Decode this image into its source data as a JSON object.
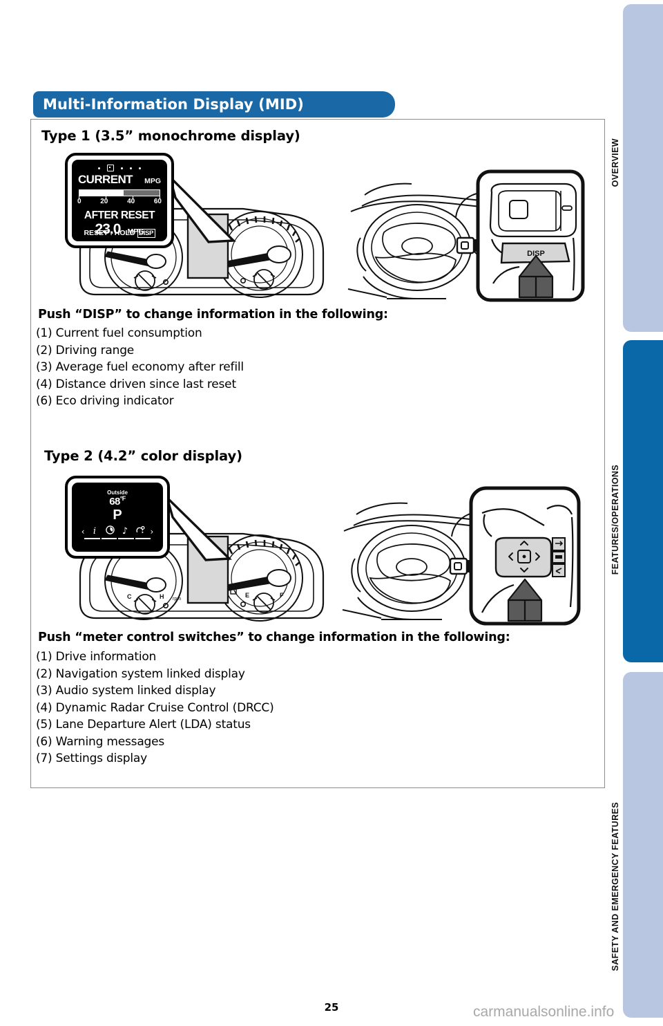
{
  "header": {
    "title": "Multi-Information Display (MID)"
  },
  "side_tabs": [
    {
      "label": "OVERVIEW",
      "active": false,
      "color": "#b9c6e2"
    },
    {
      "label": "FEATURES/OPERATIONS",
      "active": true,
      "color": "#0a68a8"
    },
    {
      "label": "SAFETY AND EMERGENCY FEATURES",
      "active": false,
      "color": "#b9c6e2"
    }
  ],
  "type1": {
    "heading": "Type 1 (3.5” monochrome display)",
    "lead": "Push “DISP” to change information in the following:",
    "items": [
      "(1) Current fuel consumption",
      "(2) Driving range",
      "(3) Average fuel economy after refill",
      "(4) Distance driven since last reset",
      "(6) Eco driving indicator"
    ],
    "screen": {
      "label_current": "CURRENT",
      "unit_mpg": "MPG",
      "scale": [
        "0",
        "20",
        "40",
        "60"
      ],
      "bar_value": 33,
      "bar_max": 60,
      "label_after_reset": "AFTER RESET",
      "value_after_reset": "23.0",
      "unit_after_reset": "MPG",
      "reset_hint": "RESET : HOLD",
      "reset_badge": "DISP",
      "dot_count": 5,
      "dot_selected_index": 1
    },
    "callout": {
      "button_label": "DISP"
    }
  },
  "type2": {
    "heading": "Type 2 (4.2” color display)",
    "lead": "Push “meter control switches” to change information in the following:",
    "items": [
      "(1) Drive information",
      "(2) Navigation system linked display",
      "(3) Audio system linked display",
      "(4) Dynamic Radar Cruise Control (DRCC)",
      "(5) Lane Departure Alert (LDA) status",
      "(6) Warning messages",
      "(7) Settings display"
    ],
    "screen": {
      "outside_label": "Outside",
      "outside_temp": "68",
      "outside_unit": "°F",
      "gear": "P",
      "icons": [
        "info-icon",
        "gauge-icon",
        "music-note-icon",
        "cruise-icon"
      ],
      "icon_selected_index": 0,
      "chevron_left": "‹",
      "chevron_right": "›"
    }
  },
  "cluster": {
    "temp_low": "C",
    "temp_high": "H",
    "fuel_low": "E",
    "fuel_high": "F",
    "rpm_unit": "rpm"
  },
  "footer": {
    "page_number": "25",
    "watermark": "carmanualsonline.info"
  },
  "colors": {
    "header_blue": "#1b68a6",
    "tab_active": "#0a68a8",
    "tab_inactive": "#b9c6e2"
  }
}
